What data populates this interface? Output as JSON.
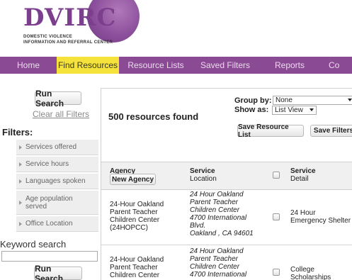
{
  "logo": {
    "name": "DVIRC",
    "subtitle_line1": "DOMESTIC VIOLENCE",
    "subtitle_line2": "INFORMATION AND REFERRAL CENTER"
  },
  "nav": {
    "items": [
      {
        "label": "Home",
        "active": false
      },
      {
        "label": "Find Resources",
        "active": true
      },
      {
        "label": "Resource Lists",
        "active": false
      },
      {
        "label": "Saved Filters",
        "active": false
      },
      {
        "label": "Reports",
        "active": false
      },
      {
        "label": "Co",
        "active": false
      }
    ]
  },
  "sidebar": {
    "run_search_label": "Run Search",
    "clear_filters_label": "Clear all Filters",
    "filters_title": "Filters:",
    "filters": [
      "Services offered",
      "Service hours",
      "Languages spoken",
      "Age population served",
      "Office Location"
    ],
    "keyword_label": "Keyword search",
    "keyword_value": "",
    "run_search_bottom_label": "Run Search"
  },
  "main": {
    "results_count": "500 resources found",
    "group_by_label": "Group by:",
    "group_by_value": "None",
    "show_as_label": "Show as:",
    "show_as_value": "List View",
    "save_list_label": "Save Resource List",
    "save_filters_label": "Save Filters"
  },
  "table": {
    "headers": {
      "agency": "Agency",
      "service_location_1": "Service",
      "service_location_2": "Location",
      "service_detail_1": "Service",
      "service_detail_2": "Detail"
    },
    "new_agency_label": "New Agency",
    "rows": [
      {
        "agency": [
          "24-Hour Oakland",
          "Parent Teacher",
          "Children Center",
          "(24HOPCC)"
        ],
        "location": [
          "24 Hour Oakland",
          "Parent Teacher",
          "Children Center",
          "4700 International",
          "Blvd.",
          "Oakland ,  CA  94601"
        ],
        "detail": [
          "24 Hour",
          "Emergency Shelter"
        ]
      },
      {
        "agency": [
          "24-Hour Oakland",
          "Parent Teacher",
          "Children Center"
        ],
        "location": [
          "24 Hour Oakland",
          "Parent Teacher",
          "Children Center",
          "4700 International"
        ],
        "detail": [
          "College",
          "Scholarships"
        ]
      }
    ]
  }
}
